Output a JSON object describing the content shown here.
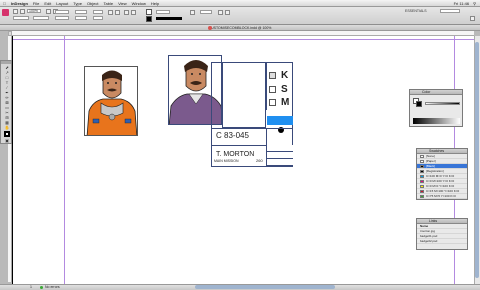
{
  "menubar": {
    "app": "InDesign",
    "items": [
      "File",
      "Edit",
      "Layout",
      "Type",
      "Object",
      "Table",
      "View",
      "Window",
      "Help"
    ],
    "time": "Fri 11:46"
  },
  "control": {
    "zoom": "100%",
    "workspace": "ESSENTIALS"
  },
  "document": {
    "title": "CUSTOMISECOMBLOCK.indd @ 100%"
  },
  "card": {
    "letters": [
      "K",
      "S",
      "M"
    ],
    "code": "C 83-045",
    "name": "T. MORTON",
    "mission": "MAIN MISSION",
    "number": "260"
  },
  "swatches_panel": {
    "title": "Swatches",
    "items": [
      "[None]",
      "[Paper]",
      "[Black]",
      "[Registration]",
      "C=100 M=0 Y=0 K=0",
      "C=0 M=100 Y=0 K=0",
      "C=0 M=0 Y=100 K=0",
      "C=15 M=100 Y=100 K=0",
      "C=75 M=5 Y=100 K=0"
    ],
    "colors": [
      "#ffffff",
      "#ffffff",
      "#000000",
      "#000000",
      "#00a0e6",
      "#e6007e",
      "#ffed00",
      "#c8102e",
      "#3aa935"
    ]
  },
  "color_panel": {
    "title": "Color"
  },
  "links_panel": {
    "title": "Links",
    "items": [
      "Name",
      "tmorton.jpg",
      "badge01.psd",
      "badge02.psd",
      "astronaut.jpg"
    ]
  },
  "status": {
    "page": "1",
    "preflight": "No errors"
  }
}
